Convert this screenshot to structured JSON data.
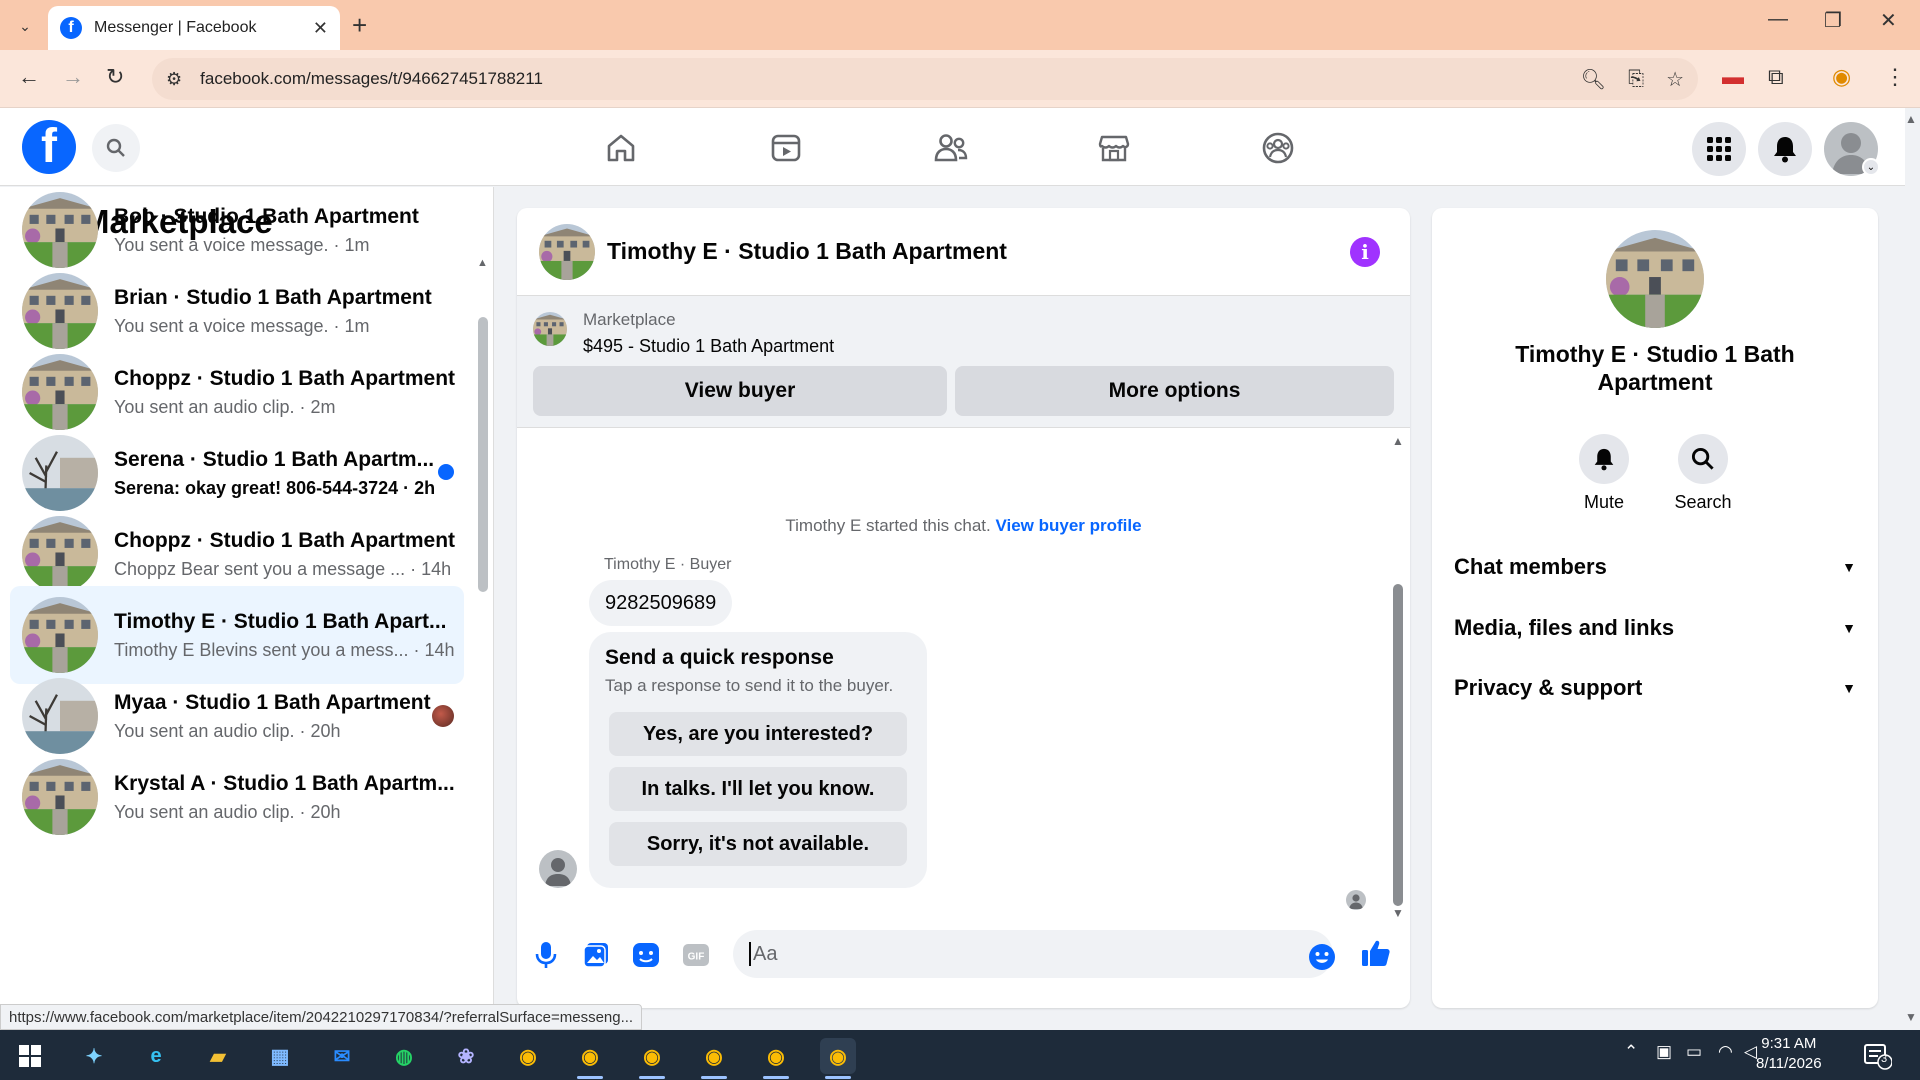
{
  "browser": {
    "tab_title": "Messenger | Facebook",
    "url": "facebook.com/messages/t/946627451788211",
    "status_url": "https://www.facebook.com/marketplace/item/2042210297170834/?referralSurface=messeng..."
  },
  "left_panel": {
    "title": "Marketplace",
    "conversations": [
      {
        "name": "Bob · Studio 1 Bath Apartment",
        "sub": "You sent a voice message. · 1m"
      },
      {
        "name": "Brian · Studio 1 Bath Apartment",
        "sub": "You sent a voice message. · 1m"
      },
      {
        "name": "Choppz · Studio 1 Bath Apartment",
        "sub": "You sent an audio clip. · 2m"
      },
      {
        "name": "Serena · Studio 1 Bath Apartm...",
        "sub": "Serena: okay great! 806-544-3724 · 2h"
      },
      {
        "name": "Choppz · Studio 1 Bath Apartment",
        "sub": "Choppz Bear sent you a message ... · 14h"
      },
      {
        "name": "Timothy E · Studio 1 Bath Apart...",
        "sub": "Timothy E Blevins sent you a mess... · 14h"
      },
      {
        "name": "Myaa · Studio 1 Bath Apartment",
        "sub": "You sent an audio clip. · 20h"
      },
      {
        "name": "Krystal A · Studio 1 Bath Apartm...",
        "sub": "You sent an audio clip. · 20h"
      }
    ]
  },
  "chat": {
    "header_name": "Timothy E · Studio 1 Bath Apartment",
    "banner_label": "Marketplace",
    "banner_item": "$495 - Studio 1 Bath Apartment",
    "view_buyer_label": "View buyer",
    "more_options_label": "More options",
    "system_text": "Timothy E started this chat.",
    "system_link": "View buyer profile",
    "sender_label": "Timothy E · Buyer",
    "message_text": "9282509689",
    "quick_title": "Send a quick response",
    "quick_sub": "Tap a response to send it to the buyer.",
    "quick_replies": [
      "Yes, are you interested?",
      "In talks. I'll let you know.",
      "Sorry, it's not available."
    ],
    "input_placeholder": "Aa"
  },
  "right_panel": {
    "name": "Timothy E · Studio 1 Bath Apartment",
    "mute_label": "Mute",
    "search_label": "Search",
    "sections": [
      "Chat members",
      "Media, files and links",
      "Privacy & support"
    ]
  },
  "taskbar": {
    "time": "9:31 AM",
    "date": "8/11/2026",
    "notifications": "3"
  },
  "colors": {
    "fb_blue": "#0866ff",
    "info_purple": "#a033ff",
    "active_conv": "#ebf5ff"
  }
}
